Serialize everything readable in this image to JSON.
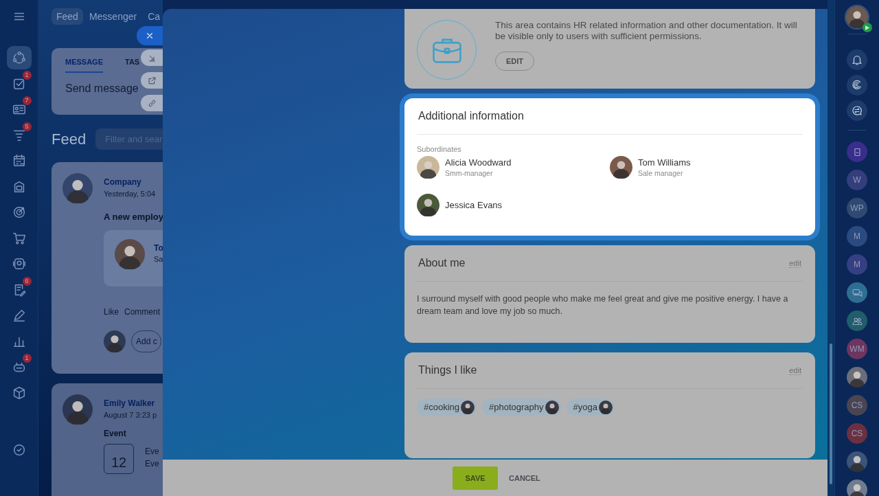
{
  "left_rail": {
    "items": [
      {
        "kind": "activity",
        "selected": true
      },
      {
        "kind": "tasks",
        "selected": false,
        "badge": "1"
      },
      {
        "kind": "cards",
        "selected": false,
        "badge": "7"
      },
      {
        "kind": "funnel",
        "selected": false,
        "badge": "5"
      },
      {
        "kind": "calendar",
        "selected": false
      },
      {
        "kind": "archive",
        "selected": false
      },
      {
        "kind": "target",
        "selected": false
      },
      {
        "kind": "cart",
        "selected": false
      },
      {
        "kind": "contact",
        "selected": false
      },
      {
        "kind": "doc-edit",
        "selected": false,
        "badge": "6"
      },
      {
        "kind": "pencil",
        "selected": false
      },
      {
        "kind": "chart",
        "selected": false
      },
      {
        "kind": "robot",
        "selected": false,
        "badge": "1"
      },
      {
        "kind": "cube",
        "selected": false
      },
      {
        "kind": "check",
        "selected": false
      }
    ]
  },
  "top_nav": [
    {
      "label": "Feed",
      "selected": true
    },
    {
      "label": "Messenger",
      "selected": false
    },
    {
      "label": "Ca",
      "selected": false
    }
  ],
  "composer": {
    "tabs": [
      {
        "label": "MESSAGE",
        "selected": true
      },
      {
        "label": "TAS",
        "selected": false
      }
    ],
    "placeholder": "Send message"
  },
  "feed": {
    "title": "Feed",
    "filter_placeholder": "Filter and sear",
    "posts": [
      {
        "author": "Company",
        "time": "Yesterday, 5:04",
        "text": "A new employ",
        "employee": {
          "name": "To",
          "role": "Sa"
        },
        "actions": [
          "Like",
          "Comment"
        ],
        "comment_placeholder": "Add c"
      },
      {
        "author": "Emily Walker",
        "time": "August 7 3:23 p",
        "type": "Event",
        "event_day": "12",
        "event_title": "Eve",
        "event_sub": "Eve"
      }
    ]
  },
  "hr_card": {
    "text": "This area contains HR related information and other documentation. It will be visible only to users with sufficient permissions.",
    "button": "EDIT"
  },
  "additional_info": {
    "title": "Additional information",
    "highlighted": true,
    "section_label": "Subordinates",
    "people": [
      {
        "name": "Alicia Woodward",
        "role": "Smm-manager"
      },
      {
        "name": "Tom Williams",
        "role": "Sale manager"
      },
      {
        "name": "Jessica Evans"
      }
    ]
  },
  "about_me": {
    "title": "About me",
    "edit": "edit",
    "text": "I surround myself with good people who make me feel great and give me positive energy. I have a dream team and love my job so much."
  },
  "things_i_like": {
    "title": "Things I like",
    "edit": "edit",
    "tags": [
      "#cooking",
      "#photography",
      "#yoga"
    ]
  },
  "footer": {
    "buttons": [
      {
        "label": "SAVE",
        "kind": "primary"
      },
      {
        "label": "CANCEL",
        "kind": "link"
      }
    ]
  },
  "right_rail": {
    "tools": [
      {
        "kind": "bell"
      },
      {
        "kind": "spiral"
      },
      {
        "kind": "chat-sync"
      }
    ],
    "chats": [
      {
        "kind": "book",
        "color": "#3a2e8c"
      },
      {
        "kind": "initials",
        "text": "W",
        "color": "#353e7c"
      },
      {
        "kind": "initials",
        "text": "WP",
        "color": "#2f4a72"
      },
      {
        "kind": "initials",
        "text": "M",
        "color": "#2a4a80"
      },
      {
        "kind": "initials",
        "text": "M",
        "color": "#363f82"
      },
      {
        "kind": "chat",
        "color": "#2f6e93"
      },
      {
        "kind": "people",
        "color": "#1f5e6a"
      },
      {
        "kind": "initials",
        "text": "WM",
        "color": "#6e3560"
      },
      {
        "kind": "photo",
        "color": "#6a6e7a"
      },
      {
        "kind": "initials",
        "text": "CS",
        "color": "#4a4553"
      },
      {
        "kind": "initials",
        "text": "CS",
        "color": "#6c3040"
      },
      {
        "kind": "photo",
        "color": "#3c5478"
      },
      {
        "kind": "photo",
        "color": "#6f7c90"
      }
    ]
  }
}
